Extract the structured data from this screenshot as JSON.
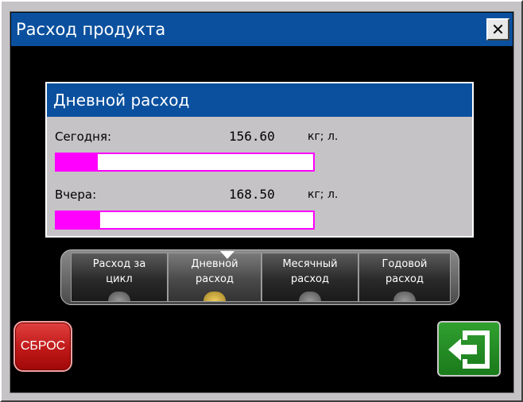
{
  "window": {
    "title": "Расход продукта",
    "close_label": "✕"
  },
  "panel": {
    "title": "Дневной расход",
    "rows": [
      {
        "label": "Сегодня:",
        "value": "156.60",
        "unit": "кг; л.",
        "fill_fraction": 0.16
      },
      {
        "label": "Вчера:",
        "value": "168.50",
        "unit": "кг; л.",
        "fill_fraction": 0.17
      }
    ]
  },
  "tabs": [
    {
      "label": "Расход за\nцикл",
      "active": false
    },
    {
      "label": "Дневной\nрасход",
      "active": true
    },
    {
      "label": "Месячный\nрасход",
      "active": false
    },
    {
      "label": "Годовой\nрасход",
      "active": false
    }
  ],
  "buttons": {
    "reset_label": "СБРОС",
    "exit_icon": "exit-door-icon"
  },
  "colors": {
    "title_bar": "#0a509e",
    "bar_fill": "#ff00ff",
    "reset": "#c01818",
    "exit": "#1a7a1a",
    "active_lamp": "#f0d060"
  }
}
